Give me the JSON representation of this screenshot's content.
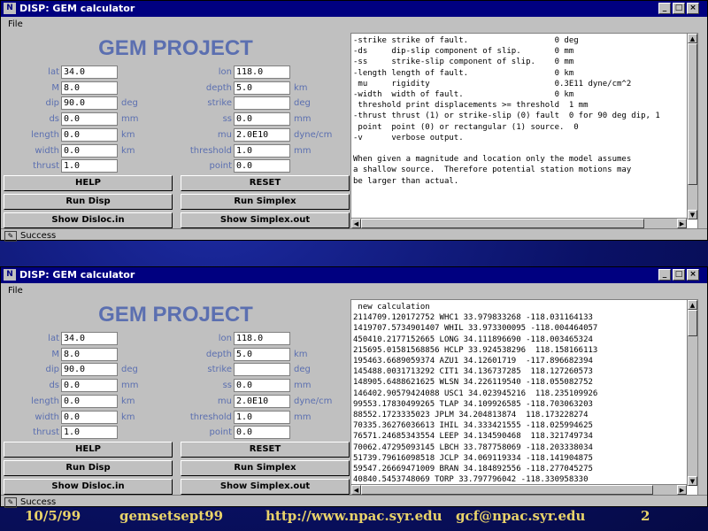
{
  "window": {
    "title": "DISP: GEM calculator",
    "icon_glyph": "N",
    "menu": "File",
    "heading": "GEM PROJECT",
    "status": "Success",
    "buttons": {
      "help": "HELP",
      "reset": "RESET",
      "run_disp": "Run Disp",
      "run_simplex": "Run Simplex",
      "show_disloc": "Show Disloc.in",
      "show_simplex": "Show Simplex.out"
    }
  },
  "form": {
    "left": [
      {
        "label": "lat",
        "value": "34.0",
        "unit": ""
      },
      {
        "label": "M",
        "value": "8.0",
        "unit": ""
      },
      {
        "label": "dip",
        "value": "90.0",
        "unit": "deg"
      },
      {
        "label": "ds",
        "value": "0.0",
        "unit": "mm"
      },
      {
        "label": "length",
        "value": "0.0",
        "unit": "km"
      },
      {
        "label": "width",
        "value": "0.0",
        "unit": "km"
      },
      {
        "label": "thrust",
        "value": "1.0",
        "unit": ""
      }
    ],
    "right": [
      {
        "label": "lon",
        "value": "118.0",
        "unit": ""
      },
      {
        "label": "depth",
        "value": "5.0",
        "unit": "km"
      },
      {
        "label": "strike",
        "value": "",
        "unit": "deg"
      },
      {
        "label": "ss",
        "value": "0.0",
        "unit": "mm"
      },
      {
        "label": "mu",
        "value": "2.0E10",
        "unit": "dyne/cm"
      },
      {
        "label": "threshold",
        "value": "1.0",
        "unit": "mm"
      },
      {
        "label": "point",
        "value": "0.0",
        "unit": ""
      }
    ]
  },
  "output_top": [
    "-strike strike of fault.                  0 deg",
    "-ds     dip-slip component of slip.       0 mm",
    "-ss     strike-slip component of slip.    0 mm",
    "-length length of fault.                  0 km",
    " mu     rigidity                          0.3E11 dyne/cm^2",
    "-width  width of fault.                   0 km",
    " threshold print displacements >= threshold  1 mm",
    "-thrust thrust (1) or strike-slip (0) fault  0 for 90 deg dip, 1",
    " point  point (0) or rectangular (1) source.  0",
    "-v      verbose output.",
    "",
    "When given a magnitude and location only the model assumes",
    "a shallow source.  Therefore potential station motions may",
    "be larger than actual."
  ],
  "output_bottom": [
    " new calculation",
    "2114709.120172752 WHC1 33.979833268 -118.031164133",
    "1419707.5734901407 WHIL 33.973300095 -118.004464057",
    "450410.2177152665 LONG 34.111896690 -118.003465324",
    "215695.01581568856 HCLP 33.924538296  118.158166113",
    "195463.6689059374 AZU1 34.12601719  -117.896682394",
    "145488.0031713292 CIT1 34.136737285  118.127260573",
    "148905.6488621625 WLSN 34.226119540 -118.055082752",
    "146402.90579424088 USC1 34.023945216  118.235109926",
    "99553.17830499265 TLAP 34.109926585 -118.703063203",
    "88552.1723335023 JPLM 34.204813874  118.173228274",
    "70335.36276036613 IHIL 34.333421555 -118.025994625",
    "76571.24685343554 LEEP 34.134590468  118.321749734",
    "70062.47295093145 LBCH 33.787758069 -118.203338034",
    "51739.79616098518 JCLP 34.069119334 -118.141904875",
    "59547.26669471009 BRAN 34.184892556 -118.277045275",
    "40840.5453748069 TORP 33.797796042 -118.330958330"
  ],
  "footer": {
    "date": "10/5/99",
    "file": "gemsetsept99",
    "url": "http://www.npac.syr.edu",
    "email": "gcf@npac.syr.edu",
    "page": "2"
  }
}
